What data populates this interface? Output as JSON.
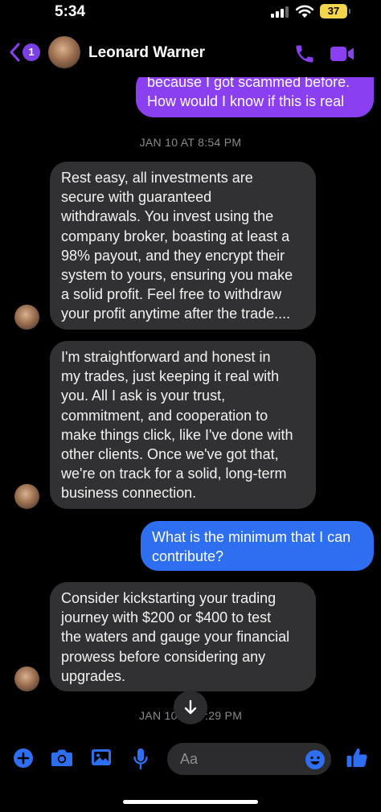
{
  "status_bar": {
    "time": "5:34",
    "battery": "37"
  },
  "header": {
    "back_count": "1",
    "contact_name": "Leonard Warner"
  },
  "colors": {
    "accent_purple": "#8a3ff0",
    "outgoing_blue": "#2e6ef0",
    "incoming_gray": "#313133"
  },
  "messages": [
    {
      "direction": "outgoing",
      "lines": [
        "because I got scammed before.",
        "How would I know if this is real"
      ]
    },
    {
      "direction": "timestamp",
      "text": "JAN 10 AT 8:54 PM"
    },
    {
      "direction": "incoming",
      "lines": [
        "Rest easy, all investments are",
        "secure with guaranteed",
        "withdrawals. You invest using the",
        "company broker, boasting at least a",
        "98% payout, and they encrypt their",
        "system to yours, ensuring you make",
        "a solid profit. Feel free to withdraw",
        "your profit anytime after the trade...."
      ]
    },
    {
      "direction": "incoming",
      "lines": [
        "I'm straightforward and honest in",
        "my trades, just keeping it real with",
        "you. All I ask is your trust,",
        "commitment, and cooperation to",
        "make things click, like I've done with",
        "other clients. Once we've got that,",
        "we're on track for a solid, long-term",
        "business connection."
      ]
    },
    {
      "direction": "outgoing",
      "lines": [
        "What is the minimum that I can",
        "contribute?"
      ]
    },
    {
      "direction": "incoming",
      "lines": [
        "Consider kickstarting your trading",
        "journey with $200 or $400 to test",
        "the waters and gauge your financial",
        "prowess before considering any",
        "upgrades."
      ]
    },
    {
      "direction": "timestamp",
      "text_left": "JAN 10",
      "text_right": ":29 PM"
    }
  ],
  "composer": {
    "placeholder": "Aa"
  },
  "icons": {
    "back": "chevron-left-icon",
    "call": "phone-icon",
    "video": "video-camera-icon",
    "scroll": "arrow-down-icon",
    "add": "plus-circle-icon",
    "camera": "camera-icon",
    "gallery": "image-icon",
    "mic": "microphone-icon",
    "emoji": "emoji-icon",
    "like": "thumbs-up-icon"
  }
}
